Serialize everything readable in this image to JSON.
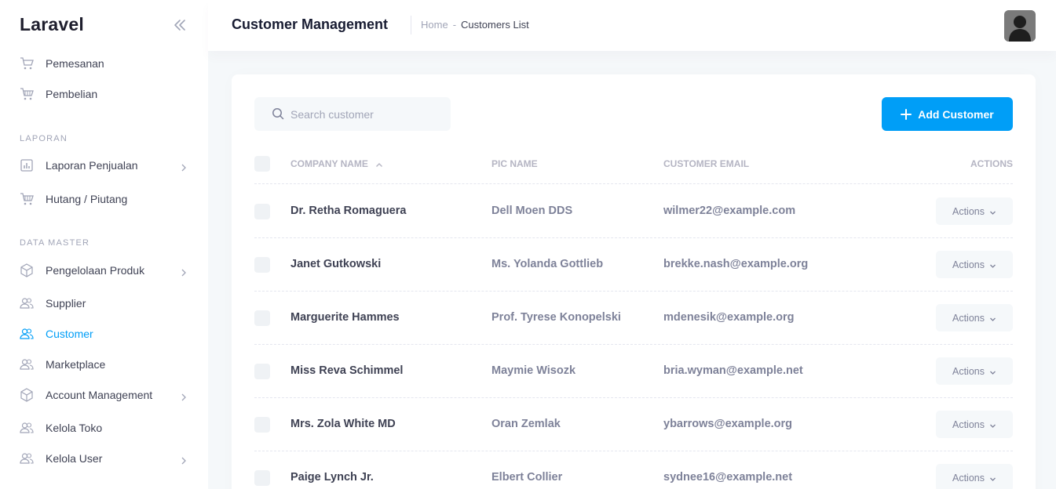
{
  "app": {
    "brand": "Laravel"
  },
  "sidebar": {
    "items_top": [
      {
        "label": "Pemesanan",
        "icon": "cart-icon"
      },
      {
        "label": "Pembelian",
        "icon": "cart-icon"
      }
    ],
    "section_laporan": "LAPORAN",
    "items_laporan": [
      {
        "label": "Laporan Penjualan",
        "icon": "chart-icon",
        "has_submenu": true
      },
      {
        "label": "Hutang / Piutang",
        "icon": "cart-icon"
      }
    ],
    "section_master": "DATA MASTER",
    "items_master": [
      {
        "label": "Pengelolaan Produk",
        "icon": "box-icon",
        "has_submenu": true
      },
      {
        "label": "Supplier",
        "icon": "users-icon"
      },
      {
        "label": "Customer",
        "icon": "users-icon",
        "active": true
      },
      {
        "label": "Marketplace",
        "icon": "users-icon"
      },
      {
        "label": "Account Management",
        "icon": "box-icon",
        "has_submenu": true
      },
      {
        "label": "Kelola Toko",
        "icon": "users-icon"
      },
      {
        "label": "Kelola User",
        "icon": "users-icon",
        "has_submenu": true
      }
    ]
  },
  "header": {
    "title": "Customer Management",
    "breadcrumb": {
      "home": "Home",
      "separator": "-",
      "current": "Customers List"
    }
  },
  "toolbar": {
    "search_placeholder": "Search customer",
    "add_label": "Add Customer"
  },
  "table": {
    "columns": {
      "company": "COMPANY NAME",
      "pic": "PIC NAME",
      "email": "CUSTOMER EMAIL",
      "actions": "ACTIONS"
    },
    "action_label": "Actions",
    "rows": [
      {
        "company": "Dr. Retha Romaguera",
        "pic": "Dell Moen DDS",
        "email": "wilmer22@example.com"
      },
      {
        "company": "Janet Gutkowski",
        "pic": "Ms. Yolanda Gottlieb",
        "email": "brekke.nash@example.org"
      },
      {
        "company": "Marguerite Hammes",
        "pic": "Prof. Tyrese Konopelski",
        "email": "mdenesik@example.org"
      },
      {
        "company": "Miss Reva Schimmel",
        "pic": "Maymie Wisozk",
        "email": "bria.wyman@example.net"
      },
      {
        "company": "Mrs. Zola White MD",
        "pic": "Oran Zemlak",
        "email": "ybarrows@example.org"
      },
      {
        "company": "Paige Lynch Jr.",
        "pic": "Elbert Collier",
        "email": "sydnee16@example.net"
      }
    ]
  },
  "colors": {
    "primary": "#009ef7",
    "sidebar_text": "#3f4254",
    "muted": "#a1a5b7"
  }
}
